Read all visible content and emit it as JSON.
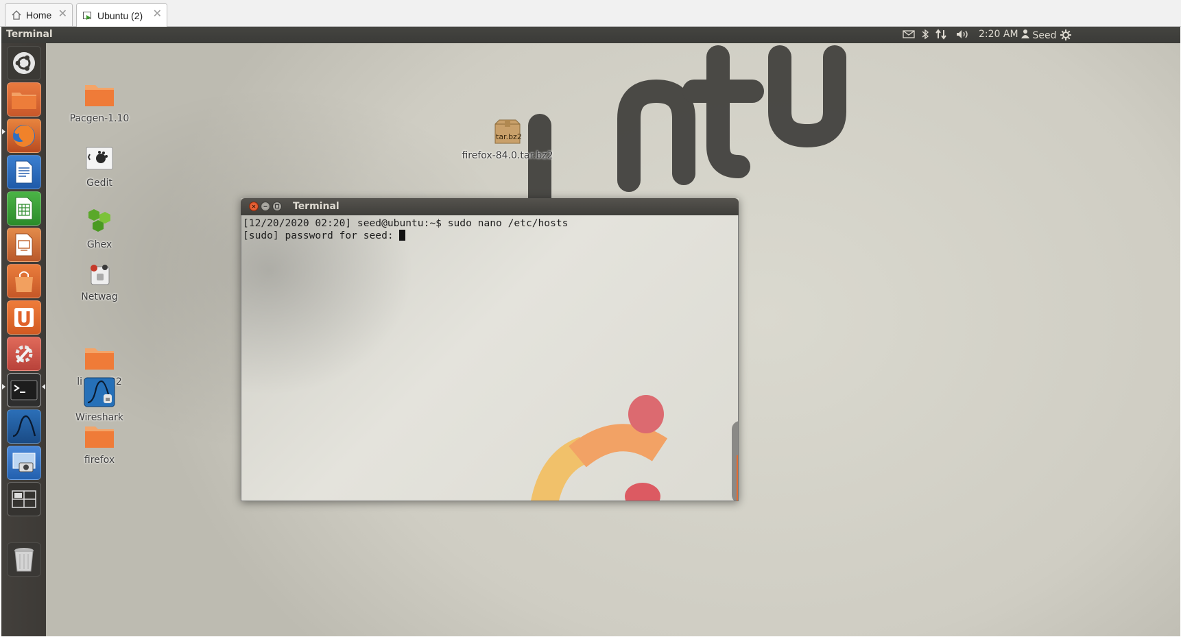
{
  "host": {
    "tabs": [
      {
        "label": "Home",
        "icon": "home-icon",
        "active": false
      },
      {
        "label": "Ubuntu (2)",
        "icon": "vm-icon",
        "active": true
      }
    ]
  },
  "panel": {
    "app_title": "Terminal",
    "indicators": {
      "mail_icon": "mail-icon",
      "bluetooth_icon": "bluetooth-icon",
      "network_icon": "network-icon",
      "sound_icon": "sound-icon",
      "clock": "2:20 AM",
      "user": "Seed",
      "session_icon": "gear-icon"
    }
  },
  "launcher": {
    "items": [
      {
        "name": "dash",
        "icon": "ubuntu-dash-icon"
      },
      {
        "name": "files",
        "icon": "folder-icon"
      },
      {
        "name": "firefox",
        "icon": "firefox-icon"
      },
      {
        "name": "writer",
        "icon": "document-icon"
      },
      {
        "name": "calc",
        "icon": "spreadsheet-icon"
      },
      {
        "name": "impress",
        "icon": "presentation-icon"
      },
      {
        "name": "software-center",
        "icon": "shopping-bag-icon"
      },
      {
        "name": "ubuntu-one",
        "icon": "ubuntu-one-icon"
      },
      {
        "name": "system-settings",
        "icon": "settings-icon"
      },
      {
        "name": "terminal",
        "icon": "terminal-icon"
      },
      {
        "name": "wireshark",
        "icon": "wireshark-icon"
      },
      {
        "name": "screenshot",
        "icon": "screenshot-icon"
      },
      {
        "name": "workspace-switcher",
        "icon": "workspaces-icon"
      },
      {
        "name": "trash",
        "icon": "trash-icon"
      }
    ]
  },
  "desktop": {
    "icons": {
      "pacgen": "Pacgen-1.10",
      "gedit": "Gedit",
      "ghex": "Ghex",
      "netwag": "Netwag",
      "libnet_partial_left": "li",
      "libnet_partial_right": "22",
      "wireshark": "Wireshark",
      "firefox_folder": "firefox",
      "firefox_archive": "firefox-84.0.tar.bz2",
      "archive_badge": "tar.bz2"
    },
    "wallpaper_text": "ubuntu"
  },
  "terminal": {
    "title": "Terminal",
    "lines": [
      "[12/20/2020 02:20] seed@ubuntu:~$ sudo nano /etc/hosts",
      "[sudo] password for seed: "
    ]
  },
  "colors": {
    "panel": "#3c3b37",
    "launcher": "#413e3a",
    "close_button": "#e0502b",
    "folder_orange": "#f07a3a"
  }
}
